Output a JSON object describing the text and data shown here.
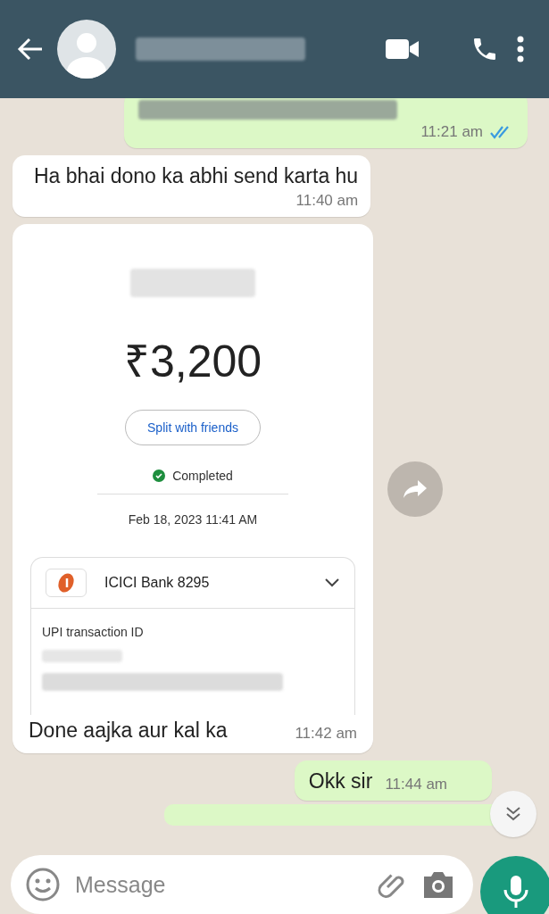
{
  "header": {
    "title_blurred": true
  },
  "messages": [
    {
      "kind": "sent",
      "text_blurred": true,
      "time": "11:21 am",
      "read": true
    },
    {
      "kind": "received",
      "text": "Ha bhai dono ka abhi send karta hu",
      "time": "11:40 am"
    },
    {
      "kind": "payment",
      "amount": "₹3,200",
      "split_button": "Split with friends",
      "status": "Completed",
      "date": "Feb 18, 2023 11:41 AM",
      "bank": "ICICI Bank 8295",
      "id_label": "UPI transaction ID",
      "caption": "Done aajka aur kal ka",
      "time": "11:42 am"
    },
    {
      "kind": "sent",
      "text": "Okk sir",
      "time": "11:44 am",
      "read": false
    }
  ],
  "composer": {
    "placeholder": "Message"
  }
}
